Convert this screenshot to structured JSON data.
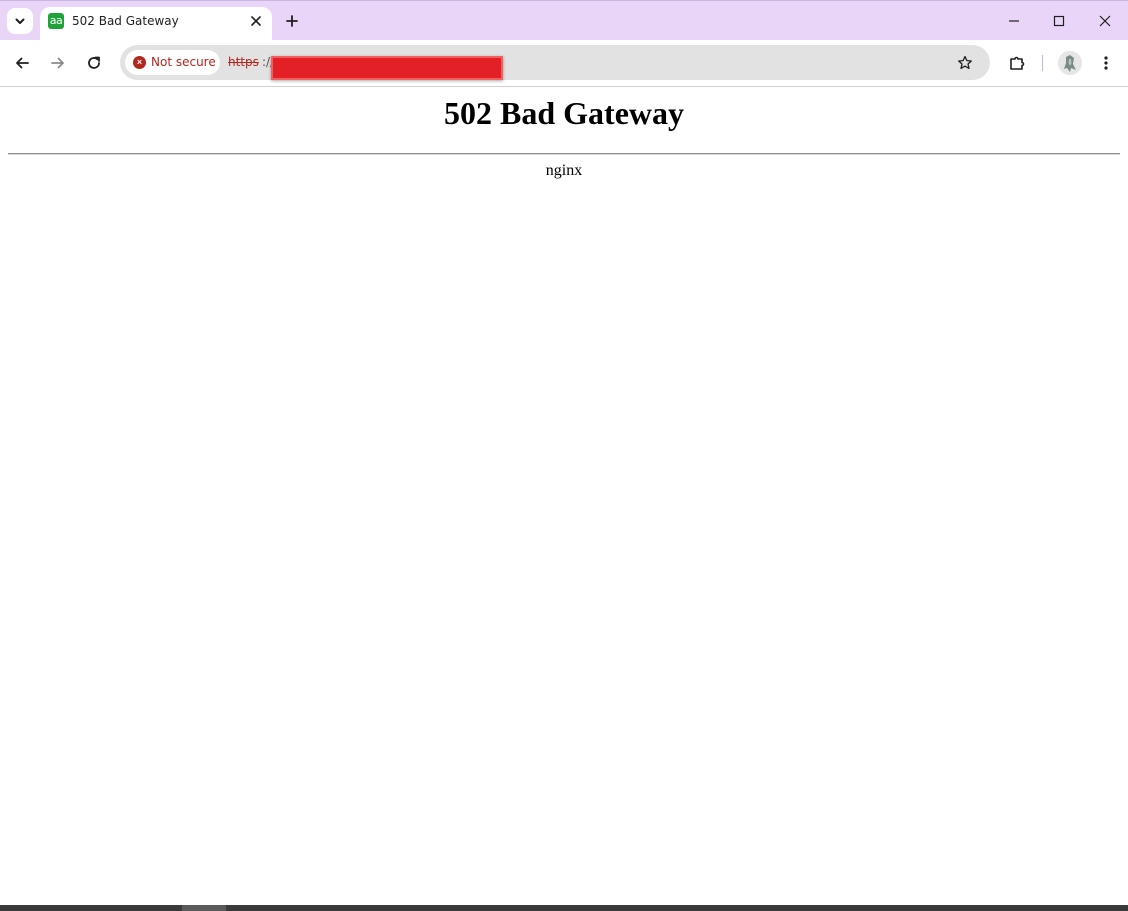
{
  "window": {
    "tab_title": "502 Bad Gateway",
    "favicon_text": "aa",
    "favicon_color": "#1fa23a",
    "titlebar_color": "#e8d5f8"
  },
  "toolbar": {
    "security_chip": "Not secure",
    "url_scheme": "https",
    "url_separator": "://",
    "url_redacted": true,
    "security_color": "#b3261e"
  },
  "icons": {
    "tab_search": "chevron-down-icon",
    "tab_close": "close-icon",
    "new_tab": "plus-icon",
    "minimize": "minimize-icon",
    "maximize": "maximize-icon",
    "close_window": "close-icon",
    "back": "arrow-left-icon",
    "forward": "arrow-right-icon",
    "reload": "reload-icon",
    "security": "warning-circle-icon",
    "bookmark": "star-icon",
    "extensions": "puzzle-icon",
    "profile": "avatar-icon",
    "menu": "kebab-menu-icon"
  },
  "page": {
    "heading": "502 Bad Gateway",
    "server": "nginx"
  }
}
